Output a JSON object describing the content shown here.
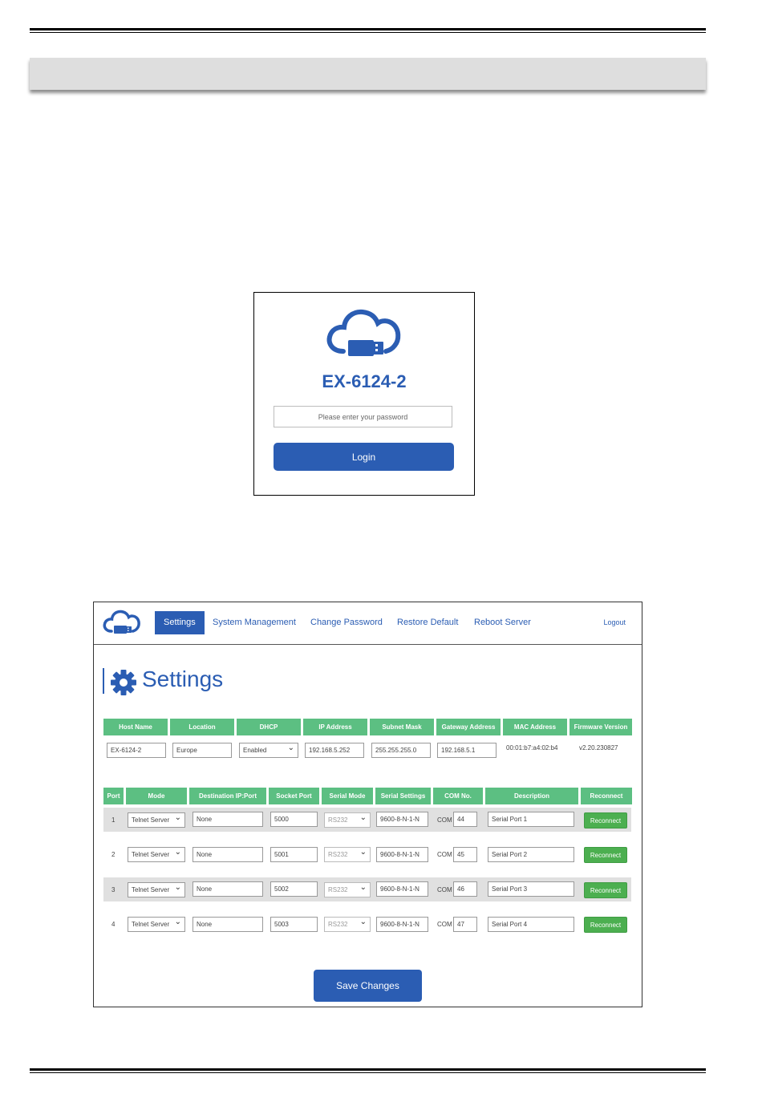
{
  "login": {
    "title": "EX-6124-2",
    "password_placeholder": "Please enter your password",
    "login_label": "Login"
  },
  "nav": {
    "items": [
      "Settings",
      "System Management",
      "Change Password",
      "Restore Default",
      "Reboot Server"
    ],
    "active": "Settings",
    "logout": "Logout"
  },
  "settings": {
    "title": "Settings",
    "network_headers": [
      "Host Name",
      "Location",
      "DHCP",
      "IP Address",
      "Subnet Mask",
      "Gateway Address",
      "MAC Address",
      "Firmware Version"
    ],
    "network_values": {
      "host_name": "EX-6124-2",
      "location": "Europe",
      "dhcp": "Enabled",
      "ip": "192.168.5.252",
      "subnet": "255.255.255.0",
      "gateway": "192.168.5.1",
      "mac": "00:01:b7:a4:02:b4",
      "firmware": "v2.20.230827"
    },
    "port_headers": [
      "Port",
      "Mode",
      "Destination IP:Port",
      "Socket Port",
      "Serial Mode",
      "Serial Settings",
      "COM No.",
      "Description",
      "Reconnect"
    ],
    "com_prefix": "COM",
    "reconnect_label": "Reconnect",
    "ports": [
      {
        "port": "1",
        "mode": "Telnet Server",
        "dest": "None",
        "socket": "5000",
        "serial_mode": "RS232",
        "serial_settings": "9600-8-N-1-N",
        "com": "44",
        "description": "Serial Port 1"
      },
      {
        "port": "2",
        "mode": "Telnet Server",
        "dest": "None",
        "socket": "5001",
        "serial_mode": "RS232",
        "serial_settings": "9600-8-N-1-N",
        "com": "45",
        "description": "Serial Port 2"
      },
      {
        "port": "3",
        "mode": "Telnet Server",
        "dest": "None",
        "socket": "5002",
        "serial_mode": "RS232",
        "serial_settings": "9600-8-N-1-N",
        "com": "46",
        "description": "Serial Port 3"
      },
      {
        "port": "4",
        "mode": "Telnet Server",
        "dest": "None",
        "socket": "5003",
        "serial_mode": "RS232",
        "serial_settings": "9600-8-N-1-N",
        "com": "47",
        "description": "Serial Port 4"
      }
    ],
    "save_label": "Save Changes"
  },
  "colors": {
    "brand_blue": "#2b5db3",
    "header_green": "#5cbf82",
    "reconnect_green": "#4caf50"
  }
}
